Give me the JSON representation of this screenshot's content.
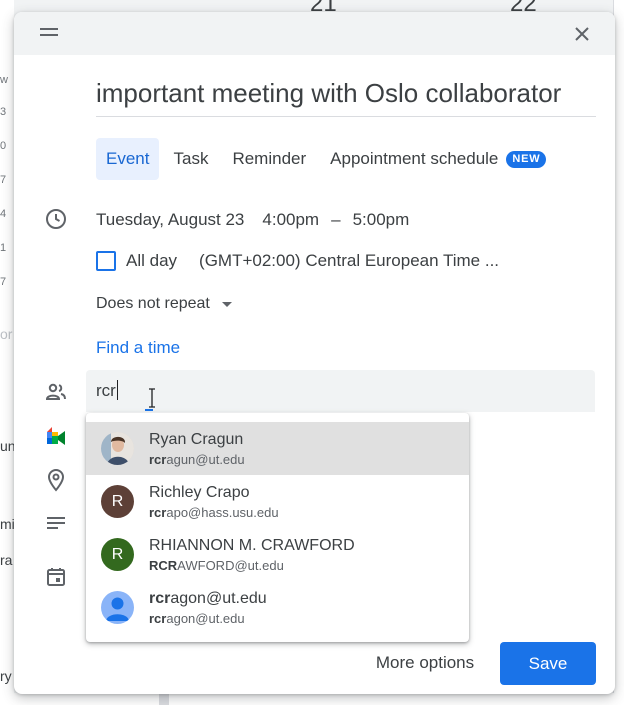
{
  "background": {
    "day_numbers": [
      "21",
      "22"
    ],
    "hour_fragments": [
      "w",
      "3",
      "0",
      "7",
      "4",
      "1",
      "7"
    ],
    "side_fragments": [
      "or",
      "un",
      "mi",
      "ra",
      "ry"
    ]
  },
  "dialog": {
    "title": "important meeting with Oslo collaborator",
    "tabs": [
      {
        "label": "Event",
        "active": true
      },
      {
        "label": "Task",
        "active": false
      },
      {
        "label": "Reminder",
        "active": false
      },
      {
        "label": "Appointment schedule",
        "active": false,
        "badge": "NEW"
      }
    ],
    "date": "Tuesday, August 23",
    "start_time": "4:00pm",
    "separator": "–",
    "end_time": "5:00pm",
    "all_day_label": "All day",
    "timezone": "(GMT+02:00) Central European Time ...",
    "repeat": "Does not repeat",
    "find_time": "Find a time",
    "guest_query": "rcr",
    "suggestions": [
      {
        "name": "Ryan Cragun",
        "email_match": "rcr",
        "email_rest": "agun@ut.edu",
        "avatar": "photo",
        "avatar_color": "#c8b6a6"
      },
      {
        "name": "Richley Crapo",
        "email_match": "rcr",
        "email_rest": "apo@hass.usu.edu",
        "avatar": "R",
        "avatar_color": "#5d4037"
      },
      {
        "name": "RHIANNON M. CRAWFORD",
        "email_match": "RCR",
        "email_rest": "AWFORD@ut.edu",
        "avatar": "R",
        "avatar_color": "#33691e"
      },
      {
        "name_match": "rcr",
        "name_rest": "agon@ut.edu",
        "email_match": "rcr",
        "email_rest": "agon@ut.edu",
        "avatar": "person-silhouette",
        "avatar_color": "#8ab4f8"
      }
    ],
    "more_options": "More options",
    "save": "Save"
  },
  "colors": {
    "accent": "#1a73e8",
    "active_tab_bg": "#e8f0fe",
    "hover_row": "#e0e0e0"
  }
}
